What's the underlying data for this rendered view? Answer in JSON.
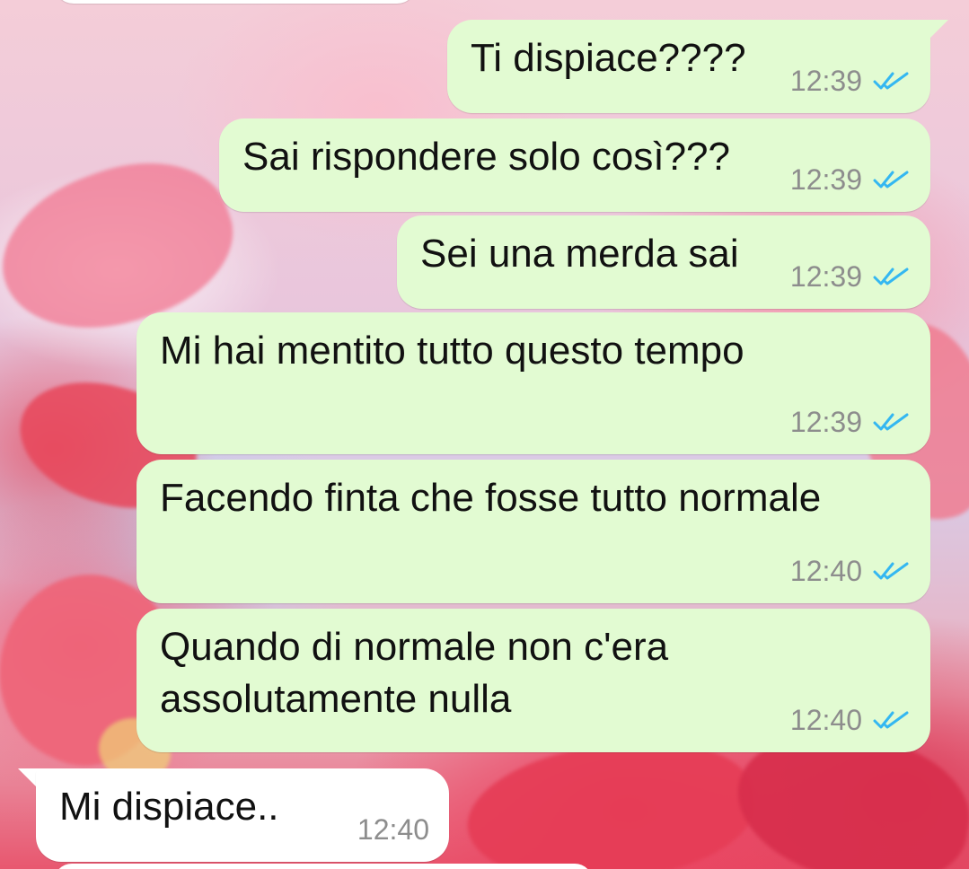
{
  "chat": {
    "theme": {
      "outgoing_bubble_color": "#e2fbd2",
      "incoming_bubble_color": "#ffffff",
      "read_tick_color": "#34b7f1",
      "timestamp_color": "#8d8d8d"
    },
    "messages": [
      {
        "direction": "outgoing",
        "text": "Ti dispiace????",
        "time": "12:39",
        "status": "read",
        "status_icon": "double-check-icon"
      },
      {
        "direction": "outgoing",
        "text": "Sai rispondere solo così???",
        "time": "12:39",
        "status": "read",
        "status_icon": "double-check-icon"
      },
      {
        "direction": "outgoing",
        "text": "Sei una merda sai",
        "time": "12:39",
        "status": "read",
        "status_icon": "double-check-icon"
      },
      {
        "direction": "outgoing",
        "text": "Mi hai mentito tutto questo tempo",
        "time": "12:39",
        "status": "read",
        "status_icon": "double-check-icon"
      },
      {
        "direction": "outgoing",
        "text": "Facendo finta che fosse tutto normale",
        "time": "12:40",
        "status": "read",
        "status_icon": "double-check-icon"
      },
      {
        "direction": "outgoing",
        "text": "Quando di normale non c'era\nassolutamente nulla",
        "time": "12:40",
        "status": "read",
        "status_icon": "double-check-icon"
      },
      {
        "direction": "incoming",
        "text": "Mi dispiace..",
        "time": "12:40"
      }
    ]
  }
}
